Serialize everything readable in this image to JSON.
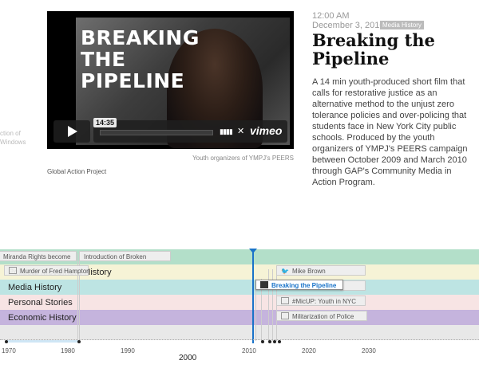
{
  "ghost": {
    "line1": "ction of",
    "line2": "Windows"
  },
  "video": {
    "overlay_title": "BREAKING\nTHE\nPIPELINE",
    "time": "14:35",
    "brand": "vimeo",
    "caption": "Youth organizers of YMPJ's PEERS",
    "credit": "Global Action Project"
  },
  "article": {
    "time": "12:00 AM",
    "date": "December 3, 2010",
    "tag": "Media History",
    "headline": "Breaking the Pipeline",
    "body": "A 14 min youth-produced short film that calls for restorative justice as an alternative method to the unjust zero tolerance policies and over-policing that students face in New York City public schools. Produced by the youth organizers of YMPJ's PEERS campaign between October 2009 and March 2010 through GAP's Community Media in Action Program."
  },
  "timeline": {
    "bands": [
      {
        "label": "",
        "color": "#b3dfc9"
      },
      {
        "label": "Political Movement History",
        "color": "#f6f3d6"
      },
      {
        "label": "Media History",
        "color": "#bde4e3"
      },
      {
        "label": "Personal Stories",
        "color": "#f7e4e4"
      },
      {
        "label": "Economic History",
        "color": "#c5b4dd"
      },
      {
        "label": "",
        "color": "#e8e8e8"
      }
    ],
    "events": {
      "miranda": "Miranda Rights become",
      "broken": "Introduction of Broken",
      "hampton": "Murder of Fred Hampton",
      "mike": "Mike Brown",
      "pipeline": "Breaking the Pipeline",
      "micup": "#MicUP: Youth in NYC",
      "militarization": "Militarization of Police"
    },
    "ticks": [
      "1970",
      "1980",
      "1990",
      "2010",
      "2020",
      "2030"
    ],
    "decade": "2000"
  }
}
